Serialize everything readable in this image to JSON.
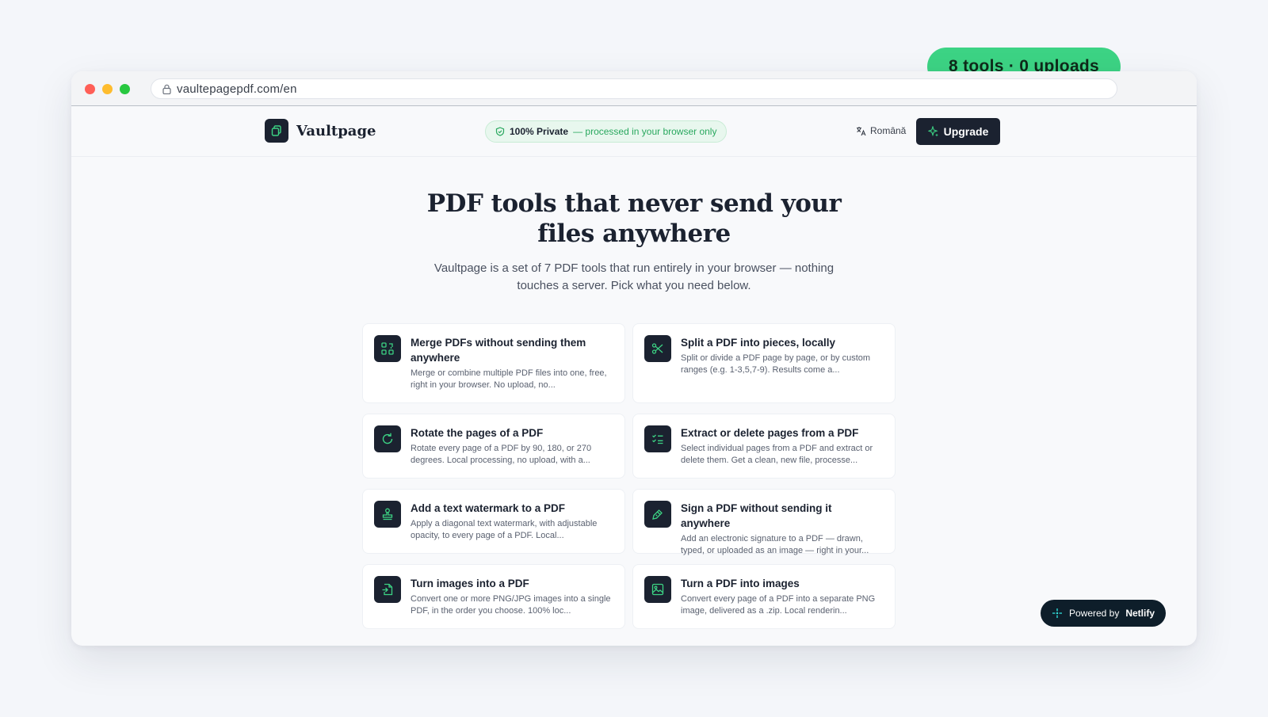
{
  "badge": "8 tools · 0 uploads",
  "browser": {
    "url": "vaultepagepdf.com/en"
  },
  "nav": {
    "brand": "Vaultpage",
    "privacy_strong": "100% Private",
    "privacy_rest": "— processed in your browser only",
    "language": "Română",
    "upgrade": "Upgrade"
  },
  "hero": {
    "title": "PDF tools that never send your files anywhere",
    "subtitle": "Vaultpage is a set of 7 PDF tools that run entirely in your browser — nothing touches a server. Pick what you need below."
  },
  "tools": [
    {
      "icon": "merge-icon",
      "title": "Merge PDFs without sending them anywhere",
      "desc": "Merge or combine multiple PDF files into one, free, right in your browser. No upload, no..."
    },
    {
      "icon": "scissors-icon",
      "title": "Split a PDF into pieces, locally",
      "desc": "Split or divide a PDF page by page, or by custom ranges (e.g. 1-3,5,7-9). Results come a..."
    },
    {
      "icon": "rotate-icon",
      "title": "Rotate the pages of a PDF",
      "desc": "Rotate every page of a PDF by 90, 180, or 270 degrees. Local processing, no upload, with a..."
    },
    {
      "icon": "checklist-icon",
      "title": "Extract or delete pages from a PDF",
      "desc": "Select individual pages from a PDF and extract or delete them. Get a clean, new file, processe..."
    },
    {
      "icon": "stamp-icon",
      "title": "Add a text watermark to a PDF",
      "desc": "Apply a diagonal text watermark, with adjustable opacity, to every page of a PDF. Local..."
    },
    {
      "icon": "pen-icon",
      "title": "Sign a PDF without sending it anywhere",
      "desc": "Add an electronic signature to a PDF — drawn, typed, or uploaded as an image — right in your..."
    },
    {
      "icon": "file-import-icon",
      "title": "Turn images into a PDF",
      "desc": "Convert one or more PNG/JPG images into a single PDF, in the order you choose. 100% loc..."
    },
    {
      "icon": "image-icon",
      "title": "Turn a PDF into images",
      "desc": "Convert every page of a PDF into a separate PNG image, delivered as a .zip. Local renderin..."
    }
  ],
  "netlify": {
    "prefix": "Powered by",
    "brand": "Netlify"
  },
  "colors": {
    "accent": "#3cd384",
    "dark": "#1b2230",
    "icon_green": "#3cd384"
  }
}
